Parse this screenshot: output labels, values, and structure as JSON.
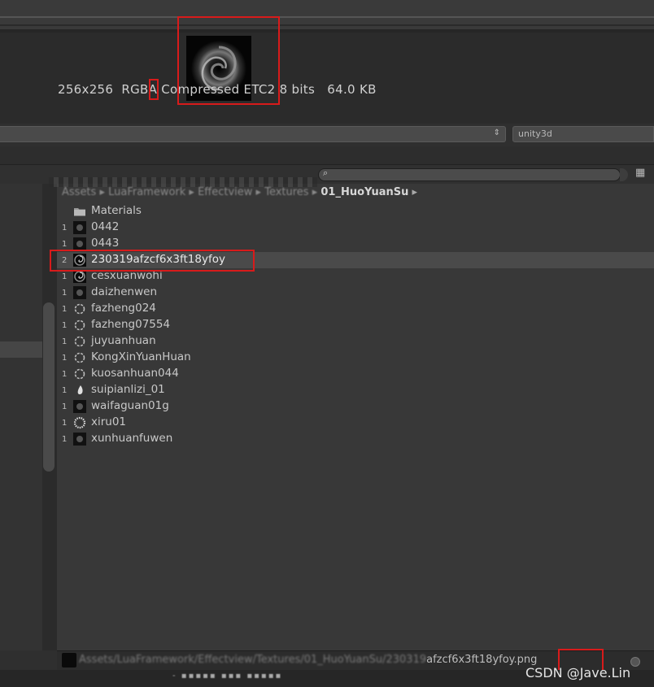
{
  "preview": {
    "info": "256x256  RGBA Compressed ETC2 8 bits   64.0 KB"
  },
  "bundle": {
    "name": "",
    "variant": "unity3d"
  },
  "search": {
    "placeholder": ""
  },
  "breadcrumb": {
    "blurred": "Assets ▸ LuaFramework ▸ Effectview ▸ Textures ▸",
    "current": "01_HuoYuanSu",
    "arrow": "▸"
  },
  "files": [
    {
      "count": "",
      "name": "Materials",
      "icon": "folder-icon"
    },
    {
      "count": "1",
      "name": "0442",
      "icon": "texture-thumb-icon"
    },
    {
      "count": "1",
      "name": "0443",
      "icon": "texture-thumb-icon"
    },
    {
      "count": "2",
      "name": "230319afzcf6x3ft18yfoy",
      "icon": "swirl-texture-icon"
    },
    {
      "count": "1",
      "name": "cesxuanwohi",
      "icon": "swirl-texture-icon"
    },
    {
      "count": "1",
      "name": "daizhenwen",
      "icon": "texture-thumb-icon"
    },
    {
      "count": "1",
      "name": "fazheng024",
      "icon": "ring-texture-icon"
    },
    {
      "count": "1",
      "name": "fazheng07554",
      "icon": "ring-texture-icon"
    },
    {
      "count": "1",
      "name": "juyuanhuan",
      "icon": "ring-texture-icon"
    },
    {
      "count": "1",
      "name": "KongXinYuanHuan",
      "icon": "ring-texture-icon"
    },
    {
      "count": "1",
      "name": "kuosanhuan044",
      "icon": "ring-texture-icon"
    },
    {
      "count": "1",
      "name": "suipianlizi_01",
      "icon": "drop-texture-icon"
    },
    {
      "count": "1",
      "name": "waifaguan01g",
      "icon": "texture-thumb-icon"
    },
    {
      "count": "1",
      "name": "xiru01",
      "icon": "burst-texture-icon"
    },
    {
      "count": "1",
      "name": "xunhuanfuwen",
      "icon": "texture-thumb-icon"
    }
  ],
  "status": {
    "path_blurred": "Assets/LuaFramework/Effectview/Textures/01_HuoYuanSu/230319",
    "path_tail": "afzcf6x3ft18yfoy.png"
  },
  "watermark": "CSDN @Jave.Lin",
  "colors": {
    "highlight_red": "#d81b1b",
    "selected_row": "#4a4a4a"
  }
}
